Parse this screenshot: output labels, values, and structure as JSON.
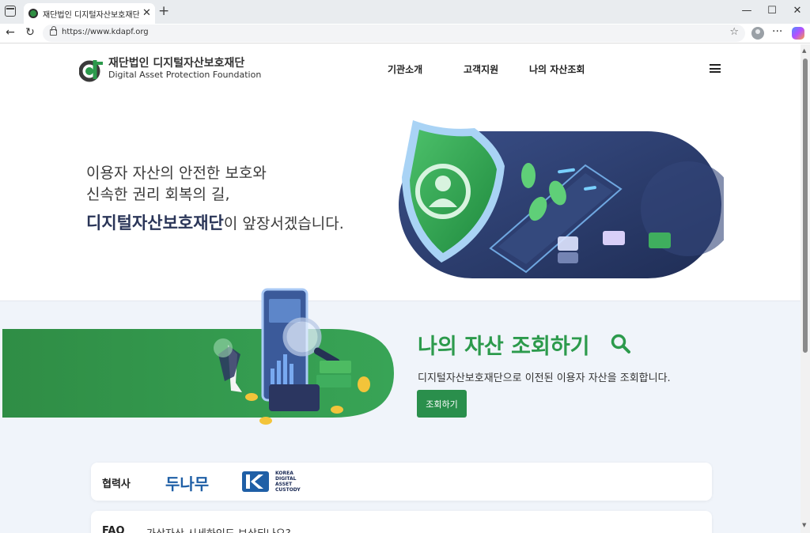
{
  "browser": {
    "tab_title": "재단법인 디지털자산보호재단(DA",
    "tab_close": "✕",
    "new_tab": "+",
    "url": "https://www.kdapf.org",
    "window_controls": {
      "minimize": "—",
      "maximize": "☐",
      "close": "✕"
    }
  },
  "header": {
    "logo_ko": "재단법인 디지털자산보호재단",
    "logo_en": "Digital Asset Protection Foundation",
    "nav": [
      "기관소개",
      "고객지원",
      "나의 자산조회"
    ]
  },
  "hero": {
    "line1": "이용자 자산의 안전한 보호와",
    "line2": "신속한 권리 회복의 길,",
    "line3_strong": "디지털자산보호재단",
    "line3_rest": "이 앞장서겠습니다."
  },
  "lookup": {
    "title": "나의 자산 조회하기",
    "description": "디지털자산보호재단으로 이전된 이용자 자산을 조회합니다.",
    "button_label": "조회하기"
  },
  "partners": {
    "label": "협력사",
    "names": [
      "두나무",
      "KOREA\nDIGITAL\nASSET\nCUSTODY"
    ]
  },
  "faq": {
    "label": "FAQ",
    "question": "가상자산 시세하인도 보상되나요?"
  },
  "colors": {
    "brand_green": "#2c9a4c",
    "brand_navy": "#2a3558",
    "band_bg": "#f0f4fa"
  }
}
